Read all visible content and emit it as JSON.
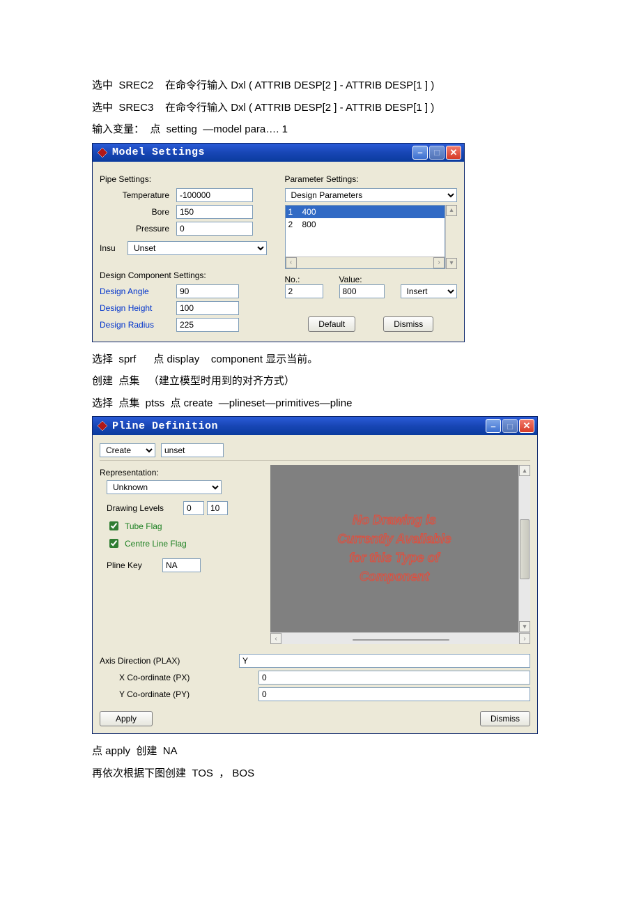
{
  "intro": {
    "line1_prefix": "选中  SREC2    在命令行输入 ",
    "line1_code": "Dxl ( ATTRIB DESP[2 ] - ATTRIB DESP[1 ] )",
    "line2_prefix": "选中  SREC3    在命令行输入 ",
    "line2_code": "Dxl ( ATTRIB DESP[2 ] - ATTRIB DESP[1 ] )",
    "line3": "输入变量：  点  setting  —model para…. 1"
  },
  "model_window": {
    "title": "Model Settings",
    "pipe_settings_label": "Pipe Settings:",
    "parameter_settings_label": "Parameter Settings:",
    "temperature_label": "Temperature",
    "temperature_value": "-100000",
    "bore_label": "Bore",
    "bore_value": "150",
    "pressure_label": "Pressure",
    "pressure_value": "0",
    "insu_label": "Insu",
    "insu_value": "Unset",
    "design_params_label": "Design Parameters",
    "list_rows": [
      {
        "idx": "1",
        "val": "400",
        "selected": true
      },
      {
        "idx": "2",
        "val": "800",
        "selected": false
      }
    ],
    "no_label": "No.:",
    "value_label": "Value:",
    "no_value": "2",
    "value_value": "800",
    "insert_option": "Insert",
    "dcs_label": "Design Component Settings:",
    "design_angle_label": "Design Angle",
    "design_angle_value": "90",
    "design_height_label": "Design Height",
    "design_height_value": "100",
    "design_radius_label": "Design Radius",
    "design_radius_value": "225",
    "default_btn": "Default",
    "dismiss_btn": "Dismiss"
  },
  "mid_text": {
    "line1": "选择  sprf      点 display    component 显示当前。",
    "line2": "创建  点集   （建立模型时用到的对齐方式）",
    "line3": "选择  点集  ptss  点 create  —plineset—primitives—pline"
  },
  "pline_window": {
    "title": "Pline Definition",
    "create_option": "Create",
    "create_value": "unset",
    "representation_label": "Representation:",
    "representation_value": "Unknown",
    "drawing_levels_label": "Drawing Levels",
    "drawing_levels_from": "0",
    "drawing_levels_to": "10",
    "tube_flag_label": "Tube Flag",
    "centre_line_flag_label": "Centre Line Flag",
    "pline_key_label": "Pline Key",
    "pline_key_value": "NA",
    "canvas_line1": "No Drawing is",
    "canvas_line2": "Currently Available",
    "canvas_line3": "for this Type of",
    "canvas_line4": "Component",
    "axis_dir_label": "Axis Direction (PLAX)",
    "axis_dir_value": "Y",
    "px_label": "X Co-ordinate (PX)",
    "px_value": "0",
    "py_label": "Y Co-ordinate (PY)",
    "py_value": "0",
    "apply_btn": "Apply",
    "dismiss_btn": "Dismiss"
  },
  "outro": {
    "line1": "点 apply  创建  NA",
    "line2": "再依次根据下图创建  TOS  ， BOS"
  }
}
